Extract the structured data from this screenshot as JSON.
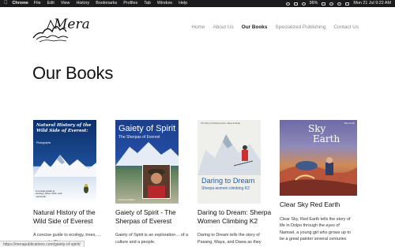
{
  "menubar": {
    "app_name": "Chrome",
    "items": [
      "File",
      "Edit",
      "View",
      "History",
      "Bookmarks",
      "Profiles",
      "Tab",
      "Window",
      "Help"
    ],
    "battery": "36%",
    "clock": "Mon 21 Jul  9:22 AM"
  },
  "logo": {
    "text": "Mera"
  },
  "nav": {
    "items": [
      {
        "label": "Home"
      },
      {
        "label": "About Us"
      },
      {
        "label": "Our Books"
      },
      {
        "label": "Specialized Publishing"
      },
      {
        "label": "Contact Us"
      }
    ],
    "active_index": 2
  },
  "page_title": "Our Books",
  "books": [
    {
      "cover": {
        "title": "Natural History of the Wild Side of Everest:",
        "subtitle": "Photographs",
        "blurb": "A concise guide to ecology, trees, birds, and mammals"
      },
      "title": "Natural History of the Wild Side of Everest",
      "description": "A concise guide to ecology, trees, ... mammals. This"
    },
    {
      "cover": {
        "title": "Gaiety of Spirit",
        "subtitle": "The Sherpas of Everest",
        "caption": "Frances Klatzel"
      },
      "title": "Gaiety of Spirit - The Sherpas of Everest",
      "description": "Gaiety of Spirit is an exploration… of a culture and a people."
    },
    {
      "cover": {
        "byline": "The Story of Pasang Lhamu, Maya & Dawa",
        "title": "Daring to Dream",
        "subtitle": "Sherpa women climbing K2"
      },
      "title": "Daring to Dream: Sherpa Women Climbing K2",
      "description": "Daring to Dream tells the story of Pasang, Maya, and Dawa as they"
    },
    {
      "cover": {
        "title_line1": "Sky",
        "title_line2": "Earth",
        "author": "Tara Cook"
      },
      "title": "Clear Sky Red Earth",
      "description": "Clear Sky, Red Earth tells the story of life in Dolpo through the eyes of Namsel, a young girl who grows up to be a great painter several centuries"
    }
  ],
  "status_bar": {
    "url": "https://merapublications.com/gaiety-of-spirit/"
  }
}
